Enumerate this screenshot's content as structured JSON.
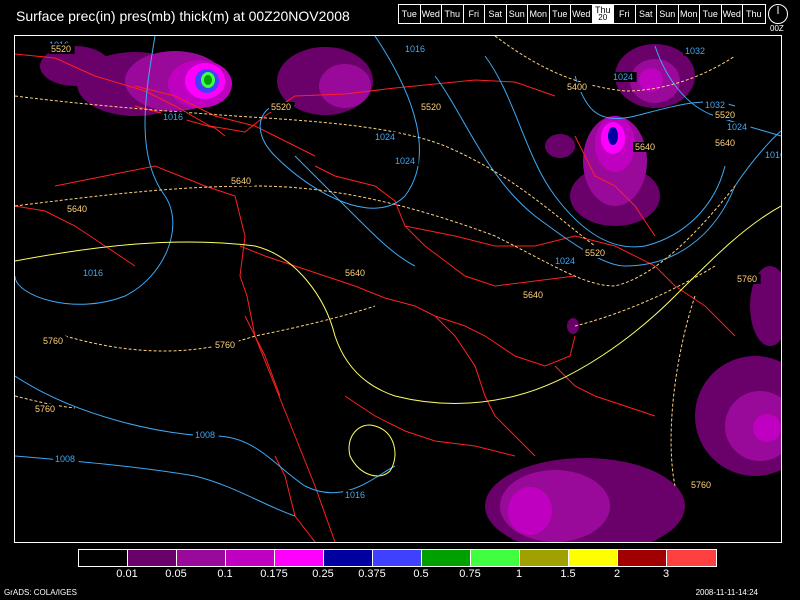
{
  "title": "Surface prec(in) pres(mb) thick(m) at 00Z20NOV2008",
  "days": [
    {
      "label": "Tue"
    },
    {
      "label": "Wed"
    },
    {
      "label": "Thu"
    },
    {
      "label": "Fri"
    },
    {
      "label": "Sat"
    },
    {
      "label": "Sun"
    },
    {
      "label": "Mon"
    },
    {
      "label": "Tue"
    },
    {
      "label": "Wed"
    },
    {
      "label": "Thu",
      "num": "20",
      "active": true
    },
    {
      "label": "Fri"
    },
    {
      "label": "Sat"
    },
    {
      "label": "Sun"
    },
    {
      "label": "Mon"
    },
    {
      "label": "Tue"
    },
    {
      "label": "Wed"
    },
    {
      "label": "Thu"
    }
  ],
  "clock_label": "00Z",
  "legend": {
    "colors": [
      "#000000",
      "#6a006a",
      "#9a0a9a",
      "#c000c0",
      "#ff00ff",
      "#0000a0",
      "#4040ff",
      "#00a000",
      "#40ff40",
      "#a0a000",
      "#ffff00",
      "#a00000",
      "#ff4040"
    ],
    "labels": [
      "0.01",
      "0.05",
      "0.1",
      "0.175",
      "0.25",
      "0.375",
      "0.5",
      "0.75",
      "1",
      "1.5",
      "2",
      "3"
    ]
  },
  "contour_labels": {
    "pressure": [
      "1016",
      "1016",
      "1024",
      "1024",
      "1024",
      "1032",
      "1024",
      "1032",
      "1024",
      "1016",
      "1016",
      "1008",
      "1008",
      "1016",
      "1016"
    ],
    "thickness": [
      "5520",
      "5520",
      "5520",
      "5400",
      "5520",
      "5640",
      "5640",
      "5640",
      "5640",
      "5640",
      "5520",
      "5640",
      "5760",
      "5760",
      "5760",
      "5760",
      "5760"
    ]
  },
  "colors": {
    "pressure": "#3fa9f5",
    "thickness_low": "#ffd27f",
    "thickness_high": "#ffff66",
    "coast": "#ff2020",
    "frame": "#ffffff"
  },
  "footer": {
    "left": "GrADS: COLA/IGES",
    "right": "2008-11-11-14:24"
  }
}
